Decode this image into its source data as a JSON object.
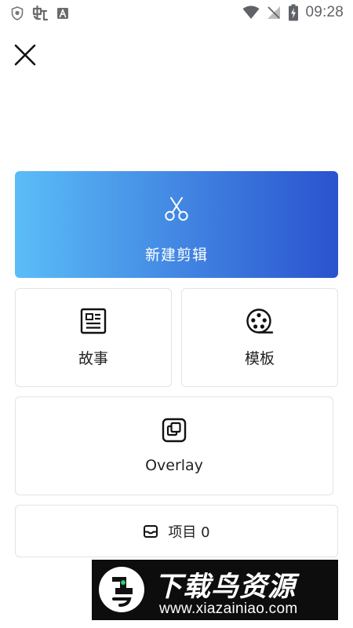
{
  "status_bar": {
    "time": "09:28",
    "left_icons": [
      "shield-icon",
      "chinese-glyph-icon",
      "a-badge-icon"
    ],
    "right_icons": [
      "wifi-icon",
      "no-signal-icon",
      "battery-charging-icon"
    ]
  },
  "header": {
    "close_icon": "close-icon"
  },
  "new_edit": {
    "label": "新建剪辑",
    "icon": "scissors-icon",
    "gradient_start": "#5bbdf7",
    "gradient_end": "#2a52cf"
  },
  "tiles": {
    "story": {
      "label": "故事",
      "icon": "document-icon"
    },
    "template": {
      "label": "模板",
      "icon": "film-reel-icon"
    },
    "overlay": {
      "label": "Overlay",
      "icon": "overlay-icon"
    }
  },
  "projects": {
    "label": "项目 0",
    "icon": "inbox-icon"
  },
  "watermark": {
    "title": "下载鸟资源",
    "url": "www.xiazainiao.com"
  }
}
